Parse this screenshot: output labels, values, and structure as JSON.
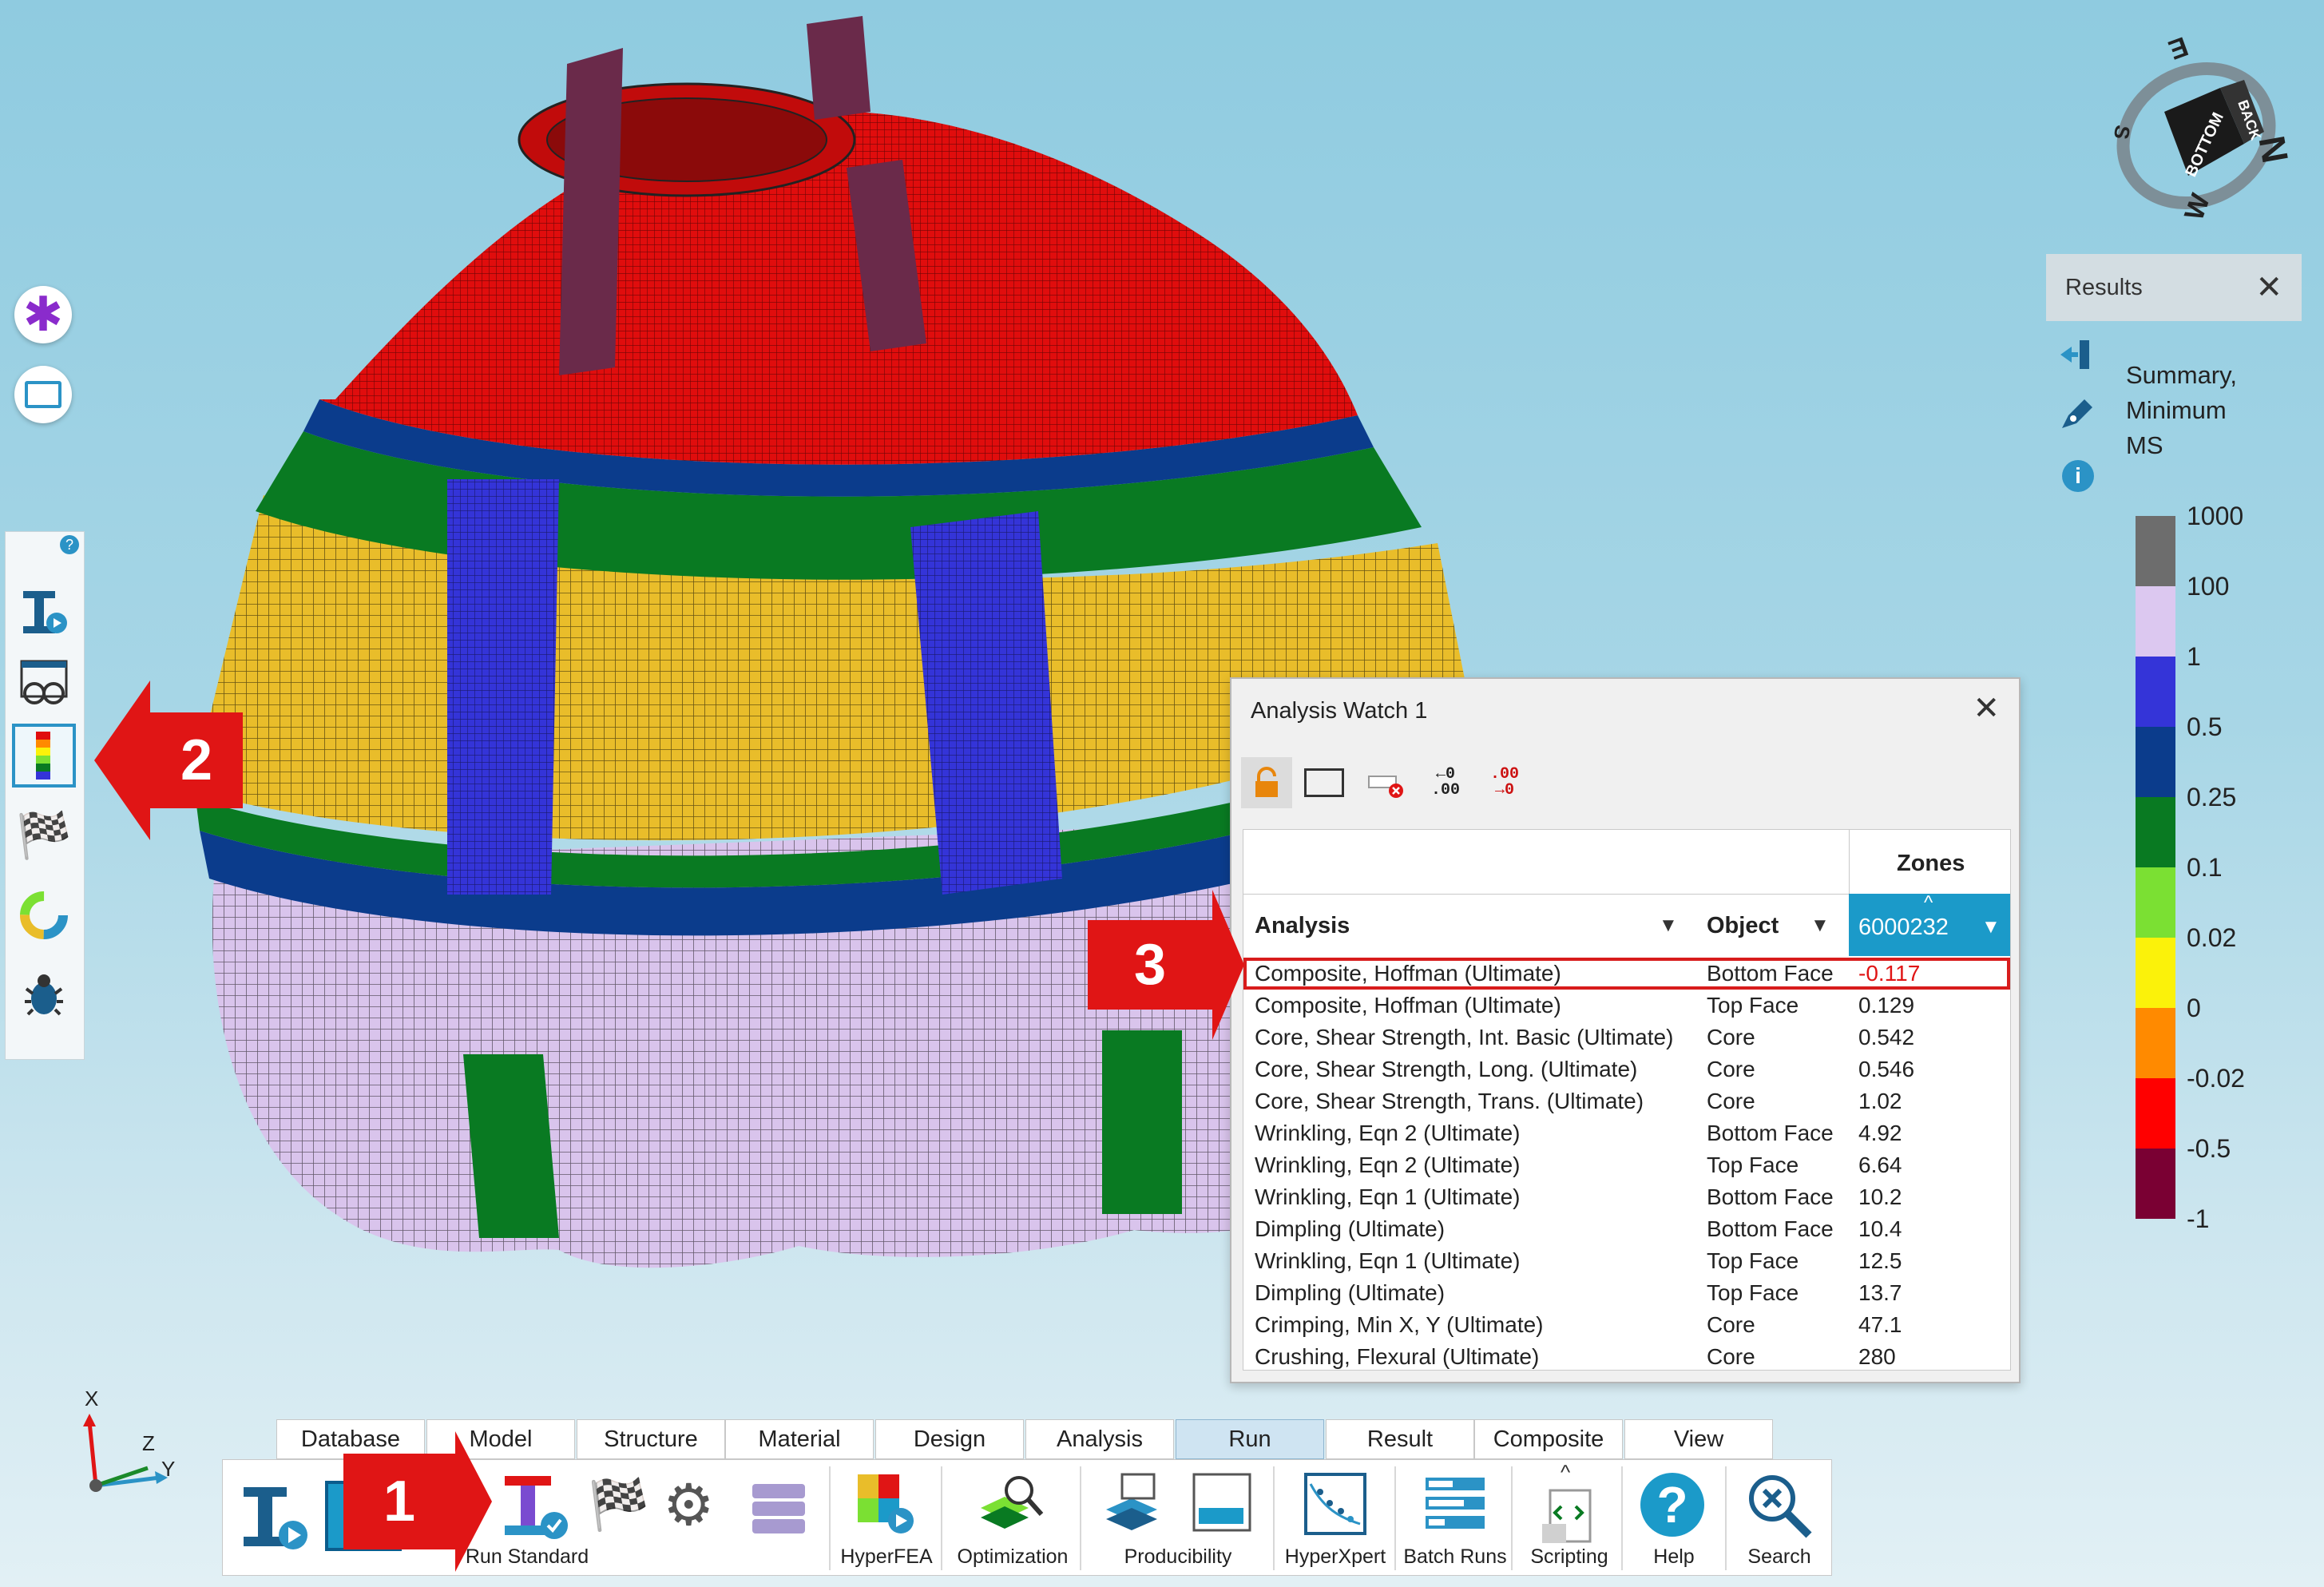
{
  "results": {
    "title": "Results",
    "mode_label_1": "Summary,",
    "mode_label_2": "Minimum",
    "mode_label_3": "MS",
    "legend": [
      {
        "label": "1000",
        "color": "#6d6d6d"
      },
      {
        "label": "100",
        "color": "#dcc8f0"
      },
      {
        "label": "1",
        "color": "#3434d8"
      },
      {
        "label": "0.5",
        "color": "#0b3c8c"
      },
      {
        "label": "0.25",
        "color": "#097a22"
      },
      {
        "label": "0.1",
        "color": "#7be033"
      },
      {
        "label": "0.02",
        "color": "#fbf20a"
      },
      {
        "label": "0",
        "color": "#ff8a00"
      },
      {
        "label": "-0.02",
        "color": "#ff0000"
      },
      {
        "label": "-0.5",
        "color": "#7a0033"
      },
      {
        "label": "-1",
        "color": ""
      }
    ]
  },
  "watch": {
    "title": "Analysis Watch 1",
    "zones_header": "Zones",
    "col_analysis": "Analysis",
    "col_object": "Object",
    "zone_id": "6000232",
    "rows": [
      {
        "analysis": "Composite, Hoffman (Ultimate)",
        "object": "Bottom Face",
        "value": "-0.117"
      },
      {
        "analysis": "Composite, Hoffman (Ultimate)",
        "object": "Top Face",
        "value": "0.129"
      },
      {
        "analysis": "Core, Shear Strength, Int. Basic (Ultimate)",
        "object": "Core",
        "value": "0.542"
      },
      {
        "analysis": "Core, Shear Strength, Long. (Ultimate)",
        "object": "Core",
        "value": "0.546"
      },
      {
        "analysis": "Core, Shear Strength, Trans. (Ultimate)",
        "object": "Core",
        "value": "1.02"
      },
      {
        "analysis": "Wrinkling, Eqn 2 (Ultimate)",
        "object": "Bottom Face",
        "value": "4.92"
      },
      {
        "analysis": "Wrinkling, Eqn 2 (Ultimate)",
        "object": "Top Face",
        "value": "6.64"
      },
      {
        "analysis": "Wrinkling, Eqn 1 (Ultimate)",
        "object": "Bottom Face",
        "value": "10.2"
      },
      {
        "analysis": "Dimpling (Ultimate)",
        "object": "Bottom Face",
        "value": "10.4"
      },
      {
        "analysis": "Wrinkling, Eqn 1 (Ultimate)",
        "object": "Top Face",
        "value": "12.5"
      },
      {
        "analysis": "Dimpling (Ultimate)",
        "object": "Top Face",
        "value": "13.7"
      },
      {
        "analysis": "Crimping, Min X, Y (Ultimate)",
        "object": "Core",
        "value": "47.1"
      },
      {
        "analysis": "Crushing, Flexural (Ultimate)",
        "object": "Core",
        "value": "280"
      }
    ]
  },
  "ribbon": {
    "tabs": [
      "Database",
      "Model",
      "Structure",
      "Material",
      "Design",
      "Analysis",
      "Run",
      "Result",
      "Composite",
      "View"
    ],
    "active_tab": "Run",
    "buttons": {
      "run_standard": "Run Standard",
      "hyperfea": "HyperFEA",
      "optimization": "Optimization",
      "producibility": "Producibility",
      "hyperxpert": "HyperXpert",
      "batch_runs": "Batch Runs",
      "scripting": "Scripting",
      "help": "Help",
      "search": "Search"
    }
  },
  "callouts": {
    "one": "1",
    "two": "2",
    "three": "3"
  },
  "nav_cube": {
    "face_front": "BOTTOM",
    "face_side": "BACK",
    "compass_e": "E",
    "compass_s": "S",
    "compass_w": "W",
    "compass_n": "N"
  },
  "axes": {
    "x": "X",
    "y": "Y",
    "z": "Z"
  },
  "wtools": {
    "t4": "←0 .00",
    "t5": ".00 →0"
  }
}
